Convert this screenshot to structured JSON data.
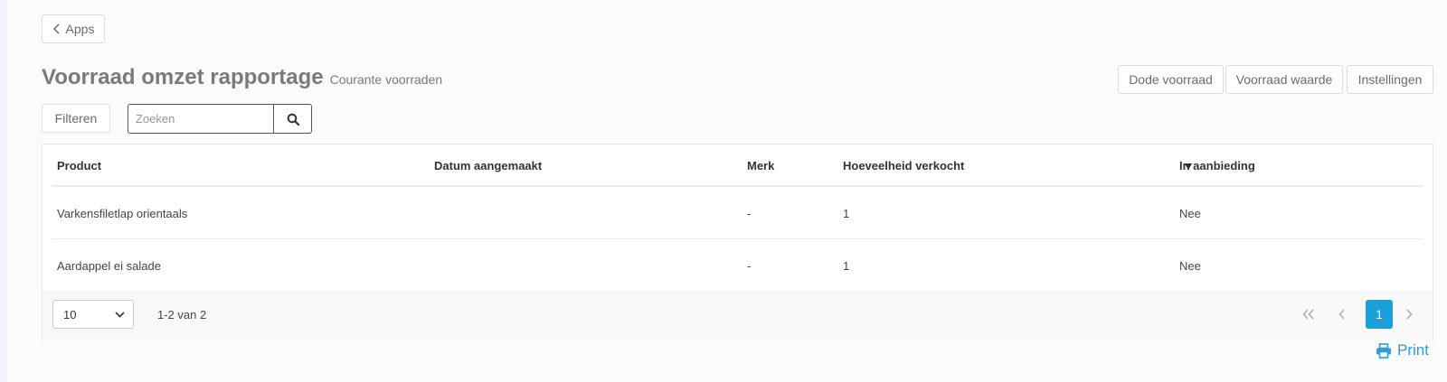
{
  "nav": {
    "back_label": "Apps"
  },
  "header": {
    "title": "Voorraad omzet rapportage",
    "subtitle": "Courante voorraden",
    "actions": [
      "Dode voorraad",
      "Voorraad waarde",
      "Instellingen"
    ]
  },
  "toolbar": {
    "filter_label": "Filteren",
    "search_placeholder": "Zoeken",
    "search_value": ""
  },
  "table": {
    "columns": [
      "Product",
      "Datum aangemaakt",
      "Merk",
      "Hoeveelheid verkocht",
      "In aanbieding"
    ],
    "sorted_column": "In aanbieding",
    "sort_direction": "descending",
    "rows": [
      [
        "Varkensfiletlap orientaals",
        "",
        "-",
        "1",
        "Nee"
      ],
      [
        "Aardappel ei salade",
        "",
        "-",
        "1",
        "Nee"
      ]
    ]
  },
  "pagination": {
    "page_size": "10",
    "range_text": "1-2 van 2",
    "current_page": "1"
  },
  "print_label": "Print",
  "colors": {
    "accent": "#1a9fdb",
    "print_link": "#2a9fd8",
    "title": "#7a7a7a"
  }
}
